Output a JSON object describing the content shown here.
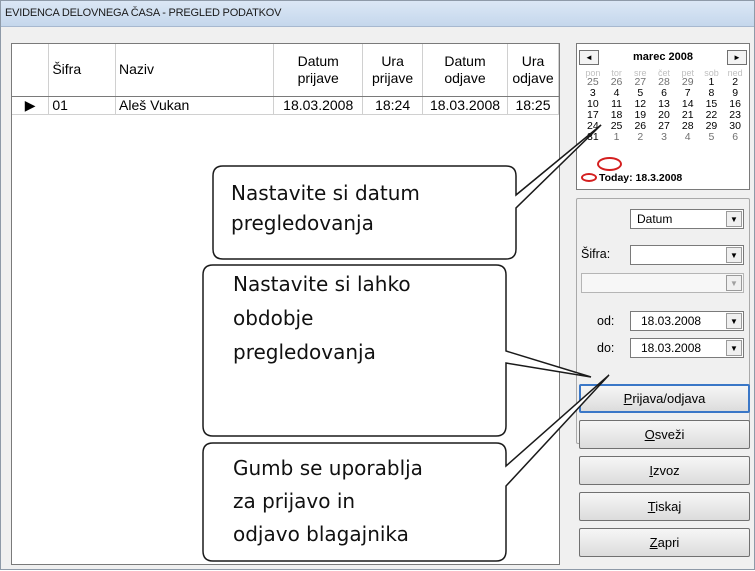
{
  "window": {
    "title": "EVIDENCA DELOVNEGA ČASA - PREGLED PODATKOV"
  },
  "grid": {
    "columns": [
      "Šifra",
      "Naziv",
      "Datum prijave",
      "Ura prijave",
      "Datum odjave",
      "Ura odjave"
    ],
    "rows": [
      {
        "indicator": "▶",
        "sifra": "01",
        "naziv": "Aleš Vukan",
        "datum_prijave": "18.03.2008",
        "ura_prijave": "18:24",
        "datum_odjave": "18.03.2008",
        "ura_odjave": "18:25"
      }
    ]
  },
  "calendar": {
    "prev": "◄",
    "next": "►",
    "month_label": "marec 2008",
    "weekdays": [
      "pon",
      "tor",
      "sre",
      "čet",
      "pet",
      "sob",
      "ned"
    ],
    "weeks": [
      [
        "25",
        "26",
        "27",
        "28",
        "29",
        "1",
        "2"
      ],
      [
        "3",
        "4",
        "5",
        "6",
        "7",
        "8",
        "9"
      ],
      [
        "10",
        "11",
        "12",
        "13",
        "14",
        "15",
        "16"
      ],
      [
        "17",
        "18",
        "19",
        "20",
        "21",
        "22",
        "23"
      ],
      [
        "24",
        "25",
        "26",
        "27",
        "28",
        "29",
        "30"
      ],
      [
        "31",
        "1",
        "2",
        "3",
        "4",
        "5",
        "6"
      ]
    ],
    "today_label": "Today: 18.3.2008"
  },
  "filter": {
    "mode_value": "Datum",
    "sifra_label": "Šifra:",
    "sifra_value": "",
    "name_value": "",
    "od_label": "od:",
    "od_value": "18.03.2008",
    "do_label": "do:",
    "do_value": "18.03.2008"
  },
  "buttons": {
    "prijava": {
      "mnemonic": "P",
      "rest": "rijava/odjava"
    },
    "osvezi": {
      "mnemonic": "O",
      "rest": "sveži"
    },
    "izvoz": {
      "mnemonic": "I",
      "rest": "zvoz"
    },
    "tiskaj": {
      "mnemonic": "T",
      "rest": "iskaj"
    },
    "zapri": {
      "mnemonic": "Z",
      "rest": "apri"
    }
  },
  "callouts": {
    "date": [
      "Nastavite si datum",
      "pregledovanja"
    ],
    "period": [
      "Nastavite si lahko",
      "obdobje",
      "pregledovanja"
    ],
    "button": [
      "Gumb se uporablja",
      "za prijavo in",
      "odjavo blagajnika"
    ]
  },
  "colors": {
    "accent": "#3a77c7",
    "today_marker": "#d41f1f",
    "titlebar": "#c5d7ec"
  }
}
